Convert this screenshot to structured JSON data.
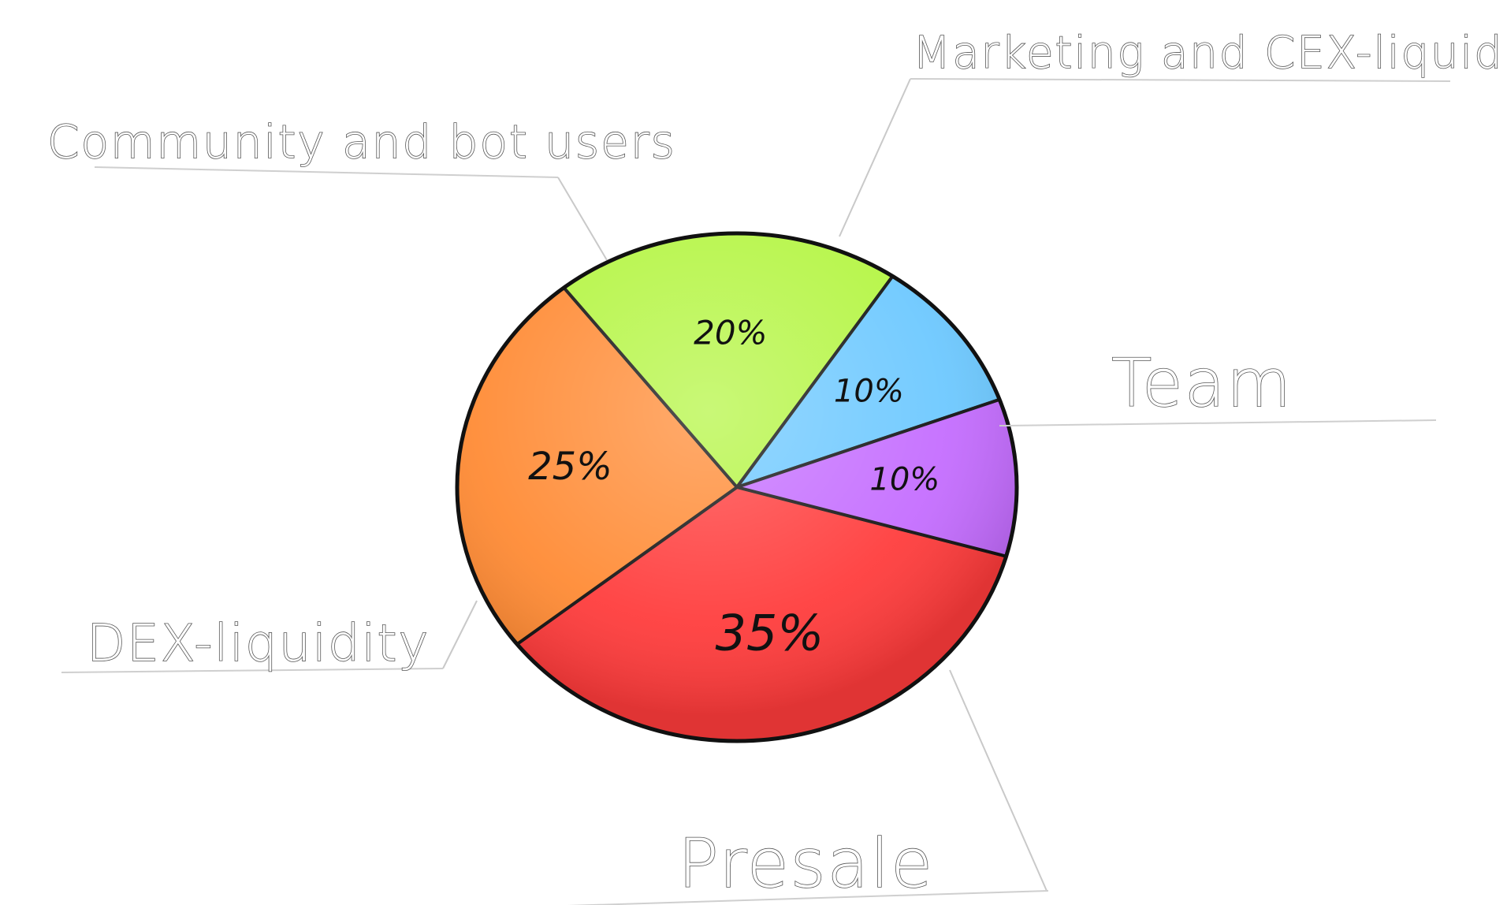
{
  "chart_data": {
    "type": "pie",
    "title": "",
    "categories": [
      "Presale",
      "DEX-liquidity",
      "Community and bot users",
      "Marketing and CEX-liquidity",
      "Team"
    ],
    "values": [
      35,
      25,
      20,
      10,
      10
    ],
    "value_labels": [
      "35%",
      "25%",
      "20%",
      "10%",
      "10%"
    ],
    "colors": [
      "#ff3b3b",
      "#ff8a33",
      "#b4f542",
      "#6cc8ff",
      "#c46cff"
    ],
    "legend": "none"
  }
}
